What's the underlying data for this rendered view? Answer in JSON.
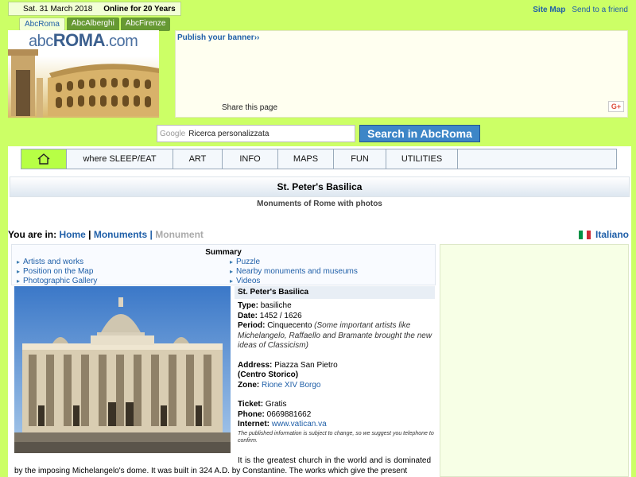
{
  "top": {
    "date": "Sat. 31 March 2018",
    "online": "Online for 20 Years",
    "tabs": [
      "AbcRoma",
      "AbcAlberghi",
      "AbcFirenze"
    ],
    "site_map": "Site Map",
    "send_friend": "Send to a friend"
  },
  "logo": {
    "abc": "abc",
    "roma": "ROMA",
    "com": ".com"
  },
  "banner": {
    "publish": "Publish your banner",
    "publish_arrow": "››",
    "share": "Share this page",
    "gplus": "G+"
  },
  "search": {
    "google": "Google",
    "placeholder": "Ricerca personalizzata",
    "button": "Search in AbcRoma"
  },
  "nav": {
    "items": [
      "where SLEEP/EAT",
      "ART",
      "INFO",
      "MAPS",
      "FUN",
      "UTILITIES"
    ]
  },
  "page": {
    "title": "St. Peter's Basilica",
    "subtitle": "Monuments of Rome with photos"
  },
  "breadcrumb": {
    "prefix": "You are in:",
    "home": "Home",
    "monuments": "Monuments",
    "current": "Monument",
    "sep": "|"
  },
  "language": {
    "label": "Italiano"
  },
  "summary": {
    "heading": "Summary",
    "left": [
      "Artists and works",
      "Position on the Map",
      "Photographic Gallery"
    ],
    "right": [
      "Puzzle",
      "Nearby monuments and museums",
      "Videos"
    ]
  },
  "info": {
    "heading": "St. Peter's Basilica",
    "type_label": "Type:",
    "type": "basiliche",
    "date_label": "Date:",
    "date": "1452 / 1626",
    "period_label": "Period:",
    "period": "Cinquecento",
    "period_note": "(Some important artists like Michelangelo, Raffaello and Bramante brought the new ideas of Classicism)",
    "address_label": "Address:",
    "address": "Piazza San Pietro",
    "district": "(Centro Storico)",
    "zone_label": "Zone:",
    "zone": "Rione XIV Borgo",
    "ticket_label": "Ticket:",
    "ticket": "Gratis",
    "phone_label": "Phone:",
    "phone": "0669881662",
    "internet_label": "Internet:",
    "internet": "www.vatican.va",
    "note": "The published information is subject to change, so we suggest you telephone to confirm."
  },
  "body": {
    "text": "It is the greatest church in the world and is dominated by the imposing Michelangelo's dome. It was built in 324 A.D. by Constantine. The works which give the present"
  },
  "colors": {
    "page_bg": "#ccff66",
    "link": "#1f5fa8",
    "home_btn": "#b7ff45",
    "search_btn": "#3d86c7"
  }
}
